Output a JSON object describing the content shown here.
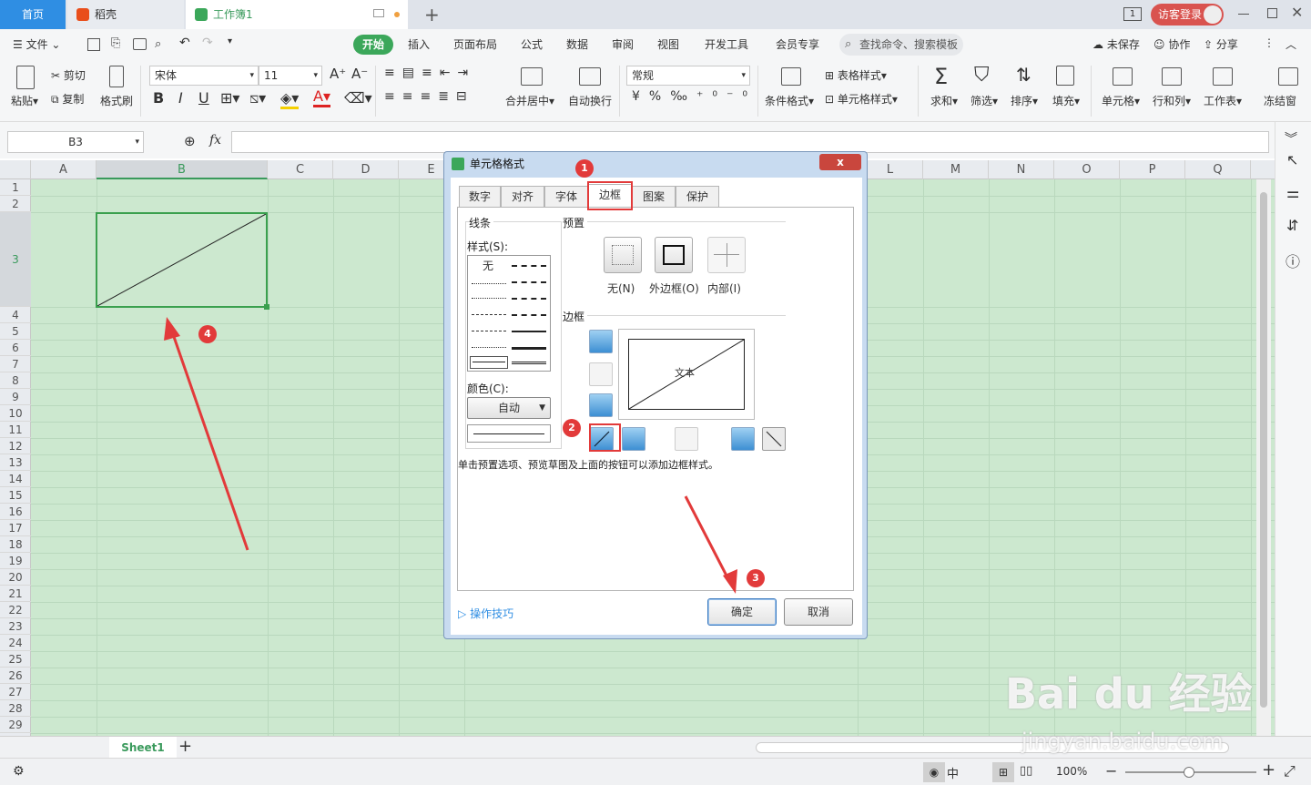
{
  "titlebar": {
    "tabs": [
      {
        "label": "首页"
      },
      {
        "label": "稻壳"
      },
      {
        "label": "工作簿1"
      }
    ],
    "login_label": "访客登录",
    "window_count": "1"
  },
  "menubar": {
    "file": "文件",
    "items": [
      "开始",
      "插入",
      "页面布局",
      "公式",
      "数据",
      "审阅",
      "视图",
      "开发工具",
      "会员专享"
    ],
    "search_placeholder": "查找命令、搜索模板",
    "unsaved": "未保存",
    "collab": "协作",
    "share": "分享"
  },
  "ribbon": {
    "paste": "粘贴",
    "cut": "剪切",
    "copy": "复制",
    "format_painter": "格式刷",
    "font_name": "宋体",
    "font_size": "11",
    "merge_center": "合并居中",
    "auto_wrap": "自动换行",
    "number_format": "常规",
    "cond_format": "条件格式",
    "table_style": "表格样式",
    "cell_style": "单元格样式",
    "sum": "求和",
    "filter": "筛选",
    "sort": "排序",
    "fill": "填充",
    "cell": "单元格",
    "row_col": "行和列",
    "worksheet": "工作表",
    "freeze": "冻结窗"
  },
  "formula_bar": {
    "name_box": "B3",
    "fx": "fx"
  },
  "grid": {
    "columns": [
      "A",
      "B",
      "C",
      "D",
      "E",
      "L",
      "M",
      "N",
      "O",
      "P",
      "Q"
    ],
    "rows": [
      "1",
      "2",
      "3",
      "4",
      "5",
      "6",
      "7",
      "8",
      "9",
      "10",
      "11",
      "12",
      "13",
      "14",
      "15",
      "16",
      "17",
      "18",
      "19",
      "20",
      "21",
      "22",
      "23",
      "24",
      "25",
      "26",
      "27",
      "28",
      "29"
    ]
  },
  "sheetbar": {
    "sheet": "Sheet1",
    "add": "+"
  },
  "statusbar": {
    "zoom": "100%",
    "input_mode": "中"
  },
  "dialog": {
    "title": "单元格格式",
    "close": "x",
    "tabs": [
      "数字",
      "对齐",
      "字体",
      "边框",
      "图案",
      "保护"
    ],
    "line_group": "线条",
    "style_label": "样式(S):",
    "none_style": "无",
    "color_label": "颜色(C):",
    "color_value": "自动",
    "preset_group": "预置",
    "preset_none": "无(N)",
    "preset_outline": "外边框(O)",
    "preset_inner": "内部(I)",
    "border_group": "边框",
    "preview_text": "文本",
    "hint": "单击预置选项、预览草图及上面的按钮可以添加边框样式。",
    "tips_link": "操作技巧",
    "ok": "确定",
    "cancel": "取消"
  },
  "annotations": [
    "1",
    "2",
    "3",
    "4"
  ],
  "watermark": {
    "brand": "Bai du 经验",
    "url": "jingyan.baidu.com"
  },
  "colors": {
    "accent_green": "#3ba75a",
    "annotation_red": "#e23a3a",
    "grid_fill": "#cce8cf",
    "home_tab_blue": "#2f8ee3"
  }
}
